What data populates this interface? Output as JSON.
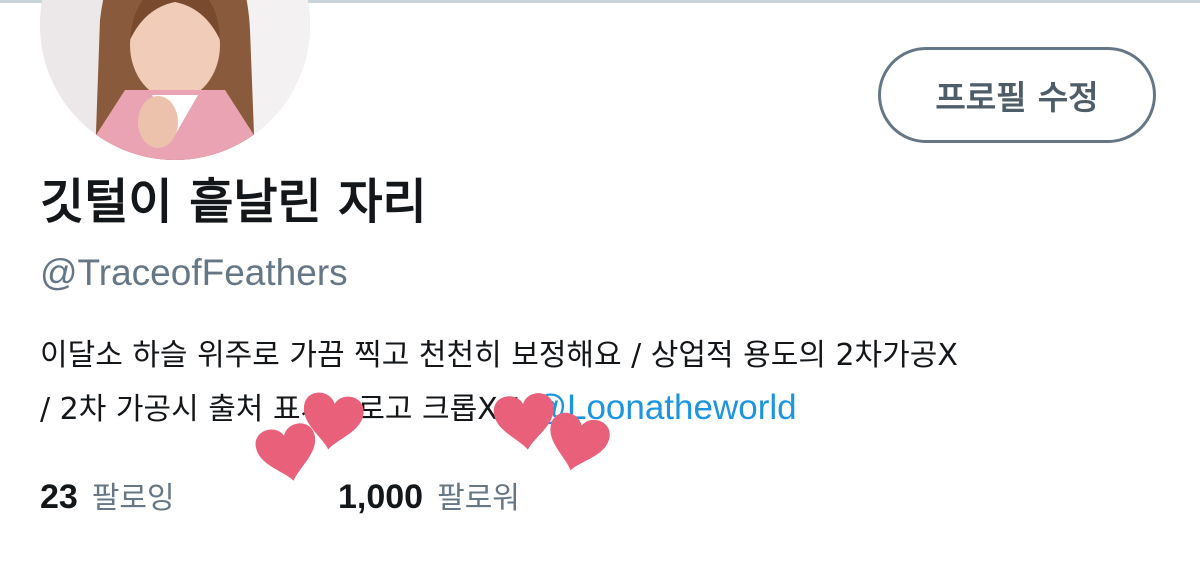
{
  "profile": {
    "edit_button_label": "프로필 수정",
    "display_name": "깃털이 흩날린 자리",
    "handle": "@TraceofFeathers",
    "bio_line1": "이달소 하슬 위주로 가끔 찍고 천천히 보정해요 / 상업적 용도의 2차가공X",
    "bio_line2": "/ 2차 가공시 출처 표시 / 로고 크롭X /",
    "bio_mention": "@Loonatheworld"
  },
  "stats": {
    "following_count": "23",
    "following_label": "팔로잉",
    "followers_count": "1,000",
    "followers_label": "팔로워"
  },
  "icons": {
    "sticker": "heart-icon"
  },
  "colors": {
    "text_primary": "#14171a",
    "text_secondary": "#657786",
    "link": "#1b95e0",
    "heart": "#e8607a",
    "button_border": "#657786"
  }
}
